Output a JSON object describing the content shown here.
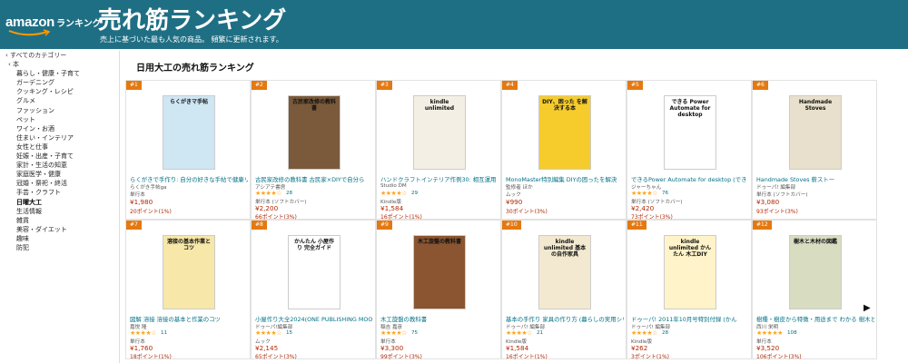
{
  "header": {
    "logo_amazon": "amazon",
    "logo_ranking": "ランキング",
    "title": "売れ筋ランキング",
    "subtitle": "売上に基づいた最も人気の商品。 頻繁に更新されます。"
  },
  "sidebar": {
    "root": "‹ すべてのカテゴリー",
    "category": "‹ 本",
    "items": [
      {
        "label": "暮らし・健康・子育て"
      },
      {
        "label": "ガーデニング"
      },
      {
        "label": "クッキング・レシピ"
      },
      {
        "label": "グルメ"
      },
      {
        "label": "ファッション"
      },
      {
        "label": "ペット"
      },
      {
        "label": "ワイン・お酒"
      },
      {
        "label": "住まい・インテリア"
      },
      {
        "label": "女性と仕事"
      },
      {
        "label": "妊娠・出産・子育て"
      },
      {
        "label": "家計・生活の知恵"
      },
      {
        "label": "家庭医学・健康"
      },
      {
        "label": "冠婚・祭祀・終活"
      },
      {
        "label": "手芸・クラフト"
      },
      {
        "label": "日曜大工",
        "selected": true
      },
      {
        "label": "生活情報"
      },
      {
        "label": "雑貨"
      },
      {
        "label": "美容・ダイエット"
      },
      {
        "label": "趣味"
      },
      {
        "label": "防犯"
      }
    ]
  },
  "main": {
    "title": "日用大工の売れ筋ランキング"
  },
  "products": [
    {
      "rank": "#1",
      "cover_text": "らくがきマ手帖",
      "cover_bg": "#cfe6f3",
      "title": "らくがきで手作り: 自分の好きな手帖で健康リ",
      "author": "らくがき手帖ga",
      "stars": "",
      "reviews": "",
      "format": "単行本",
      "price": "¥1,980",
      "points": "20ポイント(1%)"
    },
    {
      "rank": "#2",
      "cover_text": "古民家改修の教科書",
      "cover_bg": "#7a5a3a",
      "title": "古民家改修の教科書 古民家×DIYで自分ら",
      "author": "アシアテ書房",
      "stars": "★★★★☆",
      "reviews": "28",
      "format": "単行本 (ソフトカバー)",
      "price": "¥2,200",
      "points": "66ポイント(3%)"
    },
    {
      "rank": "#3",
      "cover_text": "kindle unlimited",
      "cover_bg": "#f3efe4",
      "title": "ハンドクラフトインテリア作例30: 相互運用",
      "author": "Studio DM",
      "stars": "★★★★☆",
      "reviews": "29",
      "format": "Kindle版",
      "price": "¥1,584",
      "points": "16ポイント(1%)"
    },
    {
      "rank": "#4",
      "cover_text": "DIY、困った を解決する本",
      "cover_bg": "#f6cc2c",
      "title": "MonoMaster特別編集 DIYの困ったを解決",
      "author": "監修者 ほか",
      "stars": "",
      "reviews": "",
      "format": "ムック",
      "price": "¥990",
      "points": "30ポイント(3%)"
    },
    {
      "rank": "#5",
      "cover_text": "できる Power Automate for desktop",
      "cover_bg": "#ffffff",
      "title": "できるPower Automate for desktop (でき",
      "author": "ジャーちゃん",
      "stars": "★★★★☆",
      "reviews": "76",
      "format": "単行本 (ソフトカバー)",
      "price": "¥2,420",
      "points": "73ポイント(3%)"
    },
    {
      "rank": "#6",
      "cover_text": "Handmade Stoves",
      "cover_bg": "#e8e0cc",
      "title": "Handmade Stoves 薪ストー",
      "author": "ドゥーパ! 編集部",
      "stars": "",
      "reviews": "",
      "format": "単行本 (ソフトカバー)",
      "price": "¥3,080",
      "points": "93ポイント(3%)"
    },
    {
      "rank": "#7",
      "cover_text": "溶接の基本作業とコツ",
      "cover_bg": "#f7e7a8",
      "title": "図解 溶接 溶接の基本と作業のコツ",
      "author": "嘉悦 隆",
      "stars": "★★★★☆",
      "reviews": "11",
      "format": "単行本",
      "price": "¥1,760",
      "points": "18ポイント(1%)"
    },
    {
      "rank": "#8",
      "cover_text": "かんたん 小屋作り 完全ガイド",
      "cover_bg": "#ffffff",
      "title": "小屋作り大全2024(ONE PUBLISHING MOO",
      "author": "ドゥーパ!編集部",
      "stars": "★★★★☆",
      "reviews": "15",
      "format": "ムック",
      "price": "¥2,145",
      "points": "65ポイント(3%)"
    },
    {
      "rank": "#9",
      "cover_text": "木工旋盤の教科書",
      "cover_bg": "#8a5530",
      "title": "木工旋盤の教科書",
      "author": "稲吉 嘉彦",
      "stars": "★★★★☆",
      "reviews": "75",
      "format": "単行本",
      "price": "¥3,300",
      "points": "99ポイント(3%)"
    },
    {
      "rank": "#10",
      "cover_text": "kindle unlimited 基本の自作家具",
      "cover_bg": "#f2e9d0",
      "title": "基本の手作り 家具の作り方 (暮らしの実用シリー",
      "author": "ドゥーパ! 編集部",
      "stars": "★★★★☆",
      "reviews": "21",
      "format": "Kindle版",
      "price": "¥1,584",
      "points": "16ポイント(1%)"
    },
    {
      "rank": "#11",
      "cover_text": "kindle unlimited かんたん 木工DIY",
      "cover_bg": "#fff3c9",
      "title": "ドゥーパ! 2011年10月号特別付録 (かん",
      "author": "ドゥーパ! 編集部",
      "stars": "★★★★☆",
      "reviews": "28",
      "format": "Kindle版",
      "price": "¥262",
      "points": "3ポイント(1%)"
    },
    {
      "rank": "#12",
      "cover_text": "樹木と木材の図鑑",
      "cover_bg": "#d8dcc0",
      "title": "樹種・樹皮から特徴・用途まで わかる 樹木と",
      "author": "西川 栄明",
      "stars": "★★★★★",
      "reviews": "108",
      "format": "単行本",
      "price": "¥3,520",
      "points": "106ポイント(3%)"
    }
  ],
  "pagination": {
    "next_symbol": "▶"
  }
}
